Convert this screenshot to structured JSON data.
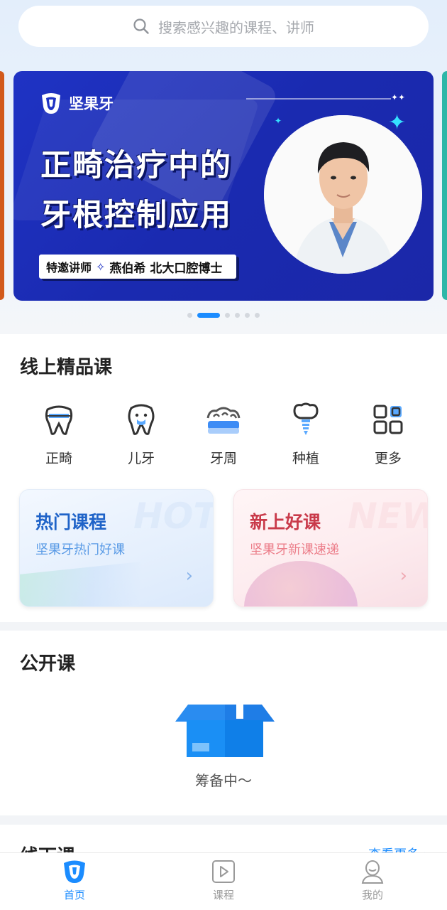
{
  "search": {
    "placeholder": "搜索感兴趣的课程、讲师"
  },
  "banner": {
    "brand": "坚果牙",
    "title_line1": "正畸治疗中的",
    "title_line2": "牙根控制应用",
    "speaker_role": "特邀讲师",
    "speaker_name": "燕伯希 北大口腔博士",
    "slide_count": 6,
    "active_slide": 2
  },
  "online_section": {
    "title": "线上精品课",
    "categories": [
      {
        "label": "正畸",
        "icon": "braces-tooth-icon"
      },
      {
        "label": "儿牙",
        "icon": "child-tooth-icon"
      },
      {
        "label": "牙周",
        "icon": "periodontal-icon"
      },
      {
        "label": "种植",
        "icon": "implant-icon"
      },
      {
        "label": "更多",
        "icon": "more-grid-icon"
      }
    ],
    "promos": [
      {
        "title": "热门课程",
        "subtitle": "坚果牙热门好课",
        "watermark": "HOT"
      },
      {
        "title": "新上好课",
        "subtitle": "坚果牙新课速递",
        "watermark": "NEW"
      }
    ]
  },
  "public_section": {
    "title": "公开课",
    "empty_text": "筹备中～"
  },
  "offline_section": {
    "title": "线下课",
    "more": "查看更多 ›"
  },
  "tabbar": [
    {
      "label": "首页",
      "icon": "home-tooth-icon",
      "active": true
    },
    {
      "label": "课程",
      "icon": "play-icon",
      "active": false
    },
    {
      "label": "我的",
      "icon": "user-icon",
      "active": false
    }
  ],
  "colors": {
    "accent": "#1b8cff",
    "banner_bg": "#1f33c4",
    "hot_title": "#1f63c8",
    "new_title": "#c93a4a"
  }
}
